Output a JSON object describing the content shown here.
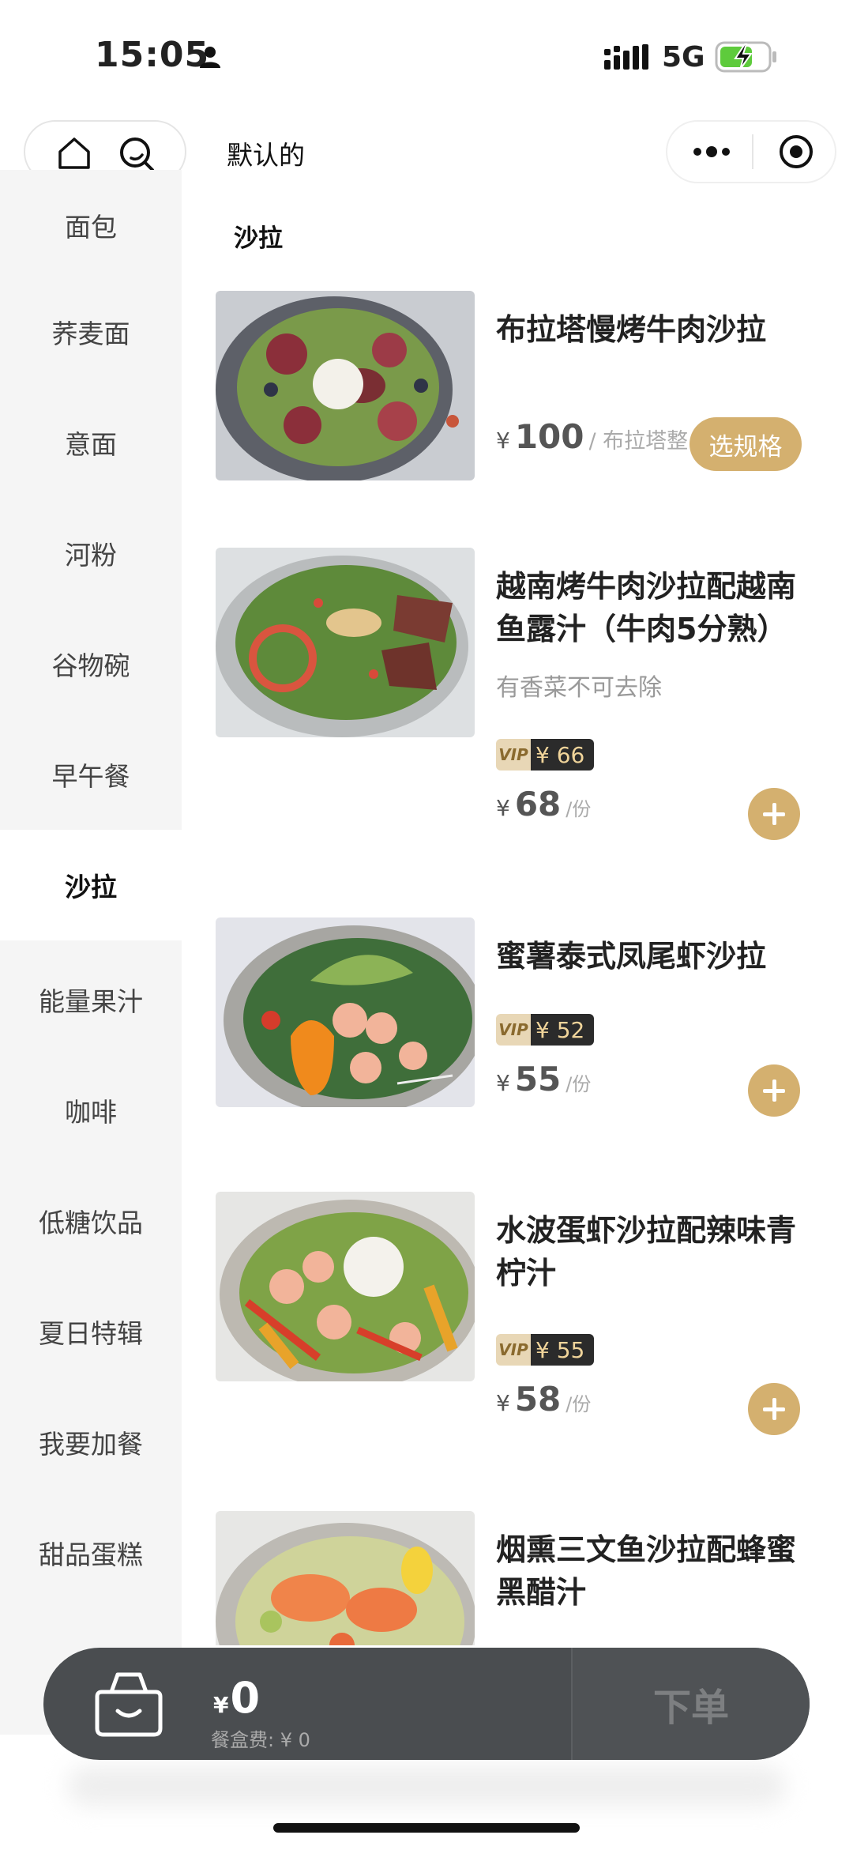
{
  "status_bar": {
    "time": "15:05",
    "network": "5G"
  },
  "header": {
    "title": "默认的"
  },
  "sidebar": {
    "items": [
      {
        "label": "面包"
      },
      {
        "label": "荞麦面"
      },
      {
        "label": "意面"
      },
      {
        "label": "河粉"
      },
      {
        "label": "谷物碗"
      },
      {
        "label": "早午餐"
      },
      {
        "label": "沙拉",
        "active": true
      },
      {
        "label": "能量果汁"
      },
      {
        "label": "咖啡"
      },
      {
        "label": "低糖饮品"
      },
      {
        "label": "夏日特辑"
      },
      {
        "label": "我要加餐"
      },
      {
        "label": "甜品蛋糕"
      }
    ]
  },
  "section": {
    "title": "沙拉"
  },
  "dishes": [
    {
      "name": "布拉塔慢烤牛肉沙拉",
      "currency": "¥",
      "price": "100",
      "spec_note": "/ 布拉塔整",
      "button_label": "选规格"
    },
    {
      "name": "越南烤牛肉沙拉配越南鱼露汁（牛肉5分熟）",
      "description": "有香菜不可去除",
      "vip_label": "VIP",
      "vip_price": "¥ 66",
      "currency": "¥",
      "price": "68",
      "unit": "/份"
    },
    {
      "name": "蜜薯泰式凤尾虾沙拉",
      "vip_label": "VIP",
      "vip_price": "¥ 52",
      "currency": "¥",
      "price": "55",
      "unit": "/份"
    },
    {
      "name": "水波蛋虾沙拉配辣味青柠汁",
      "vip_label": "VIP",
      "vip_price": "¥ 55",
      "currency": "¥",
      "price": "58",
      "unit": "/份"
    },
    {
      "name": "烟熏三文鱼沙拉配蜂蜜黑醋汁"
    }
  ],
  "cart": {
    "currency": "¥",
    "total": "0",
    "box_fee": "餐盒费: ¥ 0",
    "checkout_label": "下单"
  },
  "colors": {
    "accent": "#d4b06f",
    "cart_bar": "#4a4d50",
    "sidebar_bg": "#f5f5f5"
  }
}
